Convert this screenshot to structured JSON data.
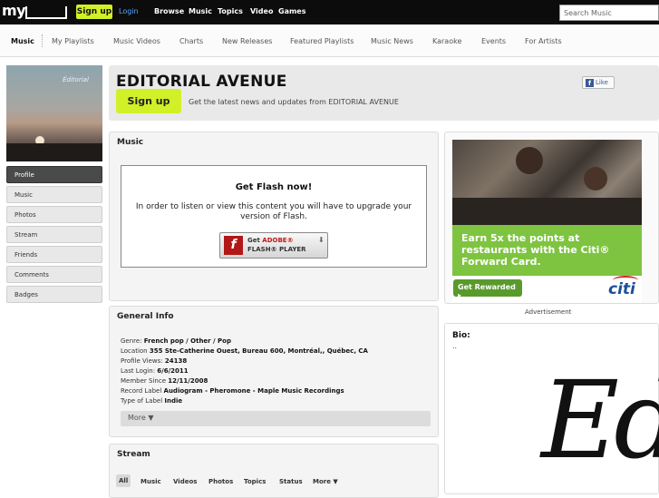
{
  "topbar": {
    "logo": "my",
    "signup_label": "Sign up",
    "login_label": "Login",
    "nav": [
      "Browse",
      "Music",
      "Topics",
      "Video",
      "Games"
    ],
    "search_placeholder": "Search Music"
  },
  "subnav": {
    "items": [
      "Music",
      "My Playlists",
      "Music Videos",
      "Charts",
      "New Releases",
      "Featured Playlists",
      "Music News",
      "Karaoke",
      "Events",
      "For Artists"
    ],
    "active": "Music"
  },
  "profile": {
    "image_text": "Éditorial",
    "menu": [
      "Profile",
      "Music",
      "Photos",
      "Stream",
      "Friends",
      "Comments",
      "Badges"
    ],
    "active_item": "Profile"
  },
  "header": {
    "artist_name": "EDITORIAL AVENUE",
    "signup_label": "Sign up",
    "signup_desc": "Get the latest news and updates from EDITORIAL AVENUE",
    "like_label": "Like"
  },
  "music_panel": {
    "title": "Music",
    "flash_title": "Get Flash now!",
    "flash_message": "In order to listen or view this content you will have to upgrade your version of Flash.",
    "flash_button_line1_a": "Get",
    "flash_button_line1_b": "ADOBE®",
    "flash_button_line2": "FLASH® PLAYER"
  },
  "general_info": {
    "title": "General Info",
    "rows": [
      {
        "label": "Genre:",
        "value": "French pop / Other / Pop"
      },
      {
        "label": "Location",
        "value": "355 Ste-Catherine Ouest, Bureau 600, Montréal,, Québec, CA"
      },
      {
        "label": "Profile Views:",
        "value": "24138"
      },
      {
        "label": "Last Login:",
        "value": "6/6/2011"
      },
      {
        "label": "Member Since",
        "value": "12/11/2008"
      },
      {
        "label": "Record Label",
        "value": "Audiogram - Pheromone - Maple Music Recordings"
      },
      {
        "label": "Type of Label",
        "value": "Indie"
      }
    ],
    "more_label": "More ▼"
  },
  "stream": {
    "title": "Stream",
    "tabs": [
      "All",
      "Music",
      "Videos",
      "Photos",
      "Topics",
      "Status",
      "More ▼"
    ],
    "active_tab": "All"
  },
  "ad": {
    "headline": "Earn 5x the points at restaurants with the Citi® Forward Card.",
    "button_label": "Get Rewarded ▸",
    "brand": "citi",
    "label": "Advertisement"
  },
  "bio": {
    "title": "Bio:",
    "text": "..",
    "image_text": "Ed"
  },
  "colors": {
    "accent_green": "#d2f028",
    "topbar": "#0c0c0c",
    "ad_green": "#7ec440",
    "citi_blue": "#1b4f9c"
  }
}
